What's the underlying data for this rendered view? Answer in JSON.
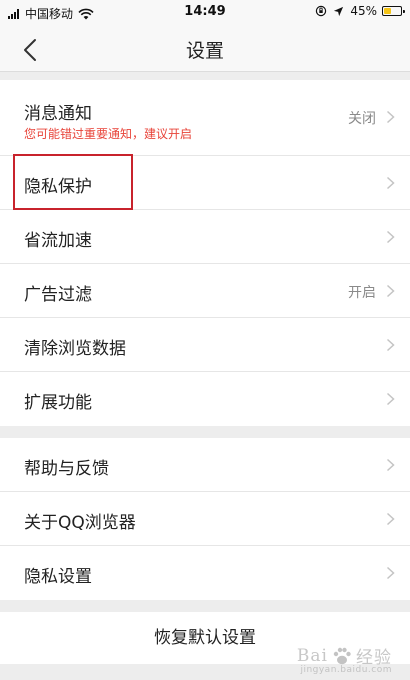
{
  "status_bar": {
    "carrier": "中国移动",
    "time": "14:49",
    "battery_percent": "45%",
    "battery_level": 0.45,
    "battery_color": "#f5c518"
  },
  "nav": {
    "title": "设置",
    "back_icon": "chevron-left-icon"
  },
  "accent_color": "#e8443a",
  "highlight_color": "#c8232c",
  "group1": [
    {
      "label": "消息通知",
      "sub": "您可能错过重要通知，建议开启",
      "value": "关闭"
    },
    {
      "label": "隐私保护",
      "value": ""
    },
    {
      "label": "省流加速",
      "value": ""
    },
    {
      "label": "广告过滤",
      "value": "开启"
    },
    {
      "label": "清除浏览数据",
      "value": ""
    },
    {
      "label": "扩展功能",
      "value": ""
    }
  ],
  "group2": [
    {
      "label": "帮助与反馈"
    },
    {
      "label": "关于QQ浏览器"
    },
    {
      "label": "隐私设置"
    }
  ],
  "restore_label": "恢复默认设置",
  "watermark": {
    "brand_a": "Bai",
    "brand_b": "经验",
    "sub": "jingyan.baidu.com"
  }
}
